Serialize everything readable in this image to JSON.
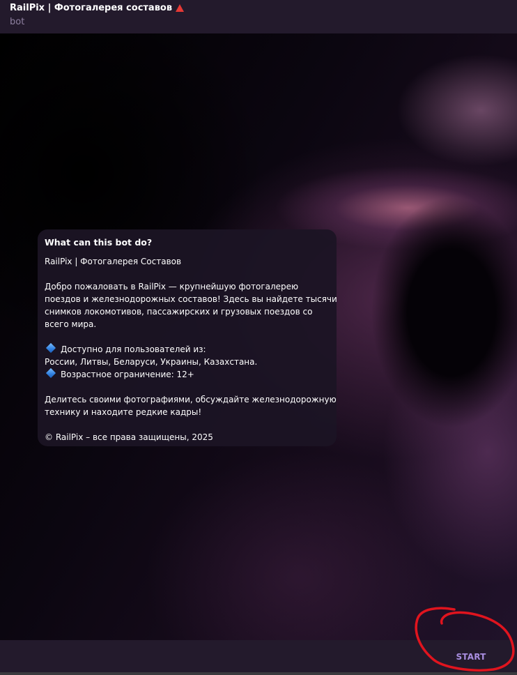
{
  "header": {
    "title": "RailPix | Фотогалерея составов",
    "title_icon": "red-triangle-icon",
    "subtitle": "bot"
  },
  "intro_card": {
    "heading": "What can this bot do?",
    "lines": [
      "RailPix | Фотогалерея Составов",
      "",
      "Добро пожаловать в RailPix — крупнейшую фотогалерею",
      "поездов и железнодорожных составов! Здесь вы найдете тысячи",
      "снимков локомотивов, пассажирских и грузовых поездов со",
      "всего мира.",
      "",
      "Доступно для пользователей из:",
      "России, Литвы, Беларуси, Украины, Казахстана.",
      "Возрастное ограничение: 12+",
      "",
      "Делитесь своими фотографиями, обсуждайте железнодорожную",
      "технику и находите редкие кадры!",
      "",
      "© RailPix – все права защищены, 2025"
    ],
    "bullet_icon": "blue-diamond-icon"
  },
  "bottom_bar": {
    "start_label": "START"
  },
  "colors": {
    "header_bg": "#231a2c",
    "accent": "#a98ee0",
    "subtitle": "#8e80a0",
    "annotation_red": "#e0141e",
    "warning_red": "#e53935"
  }
}
